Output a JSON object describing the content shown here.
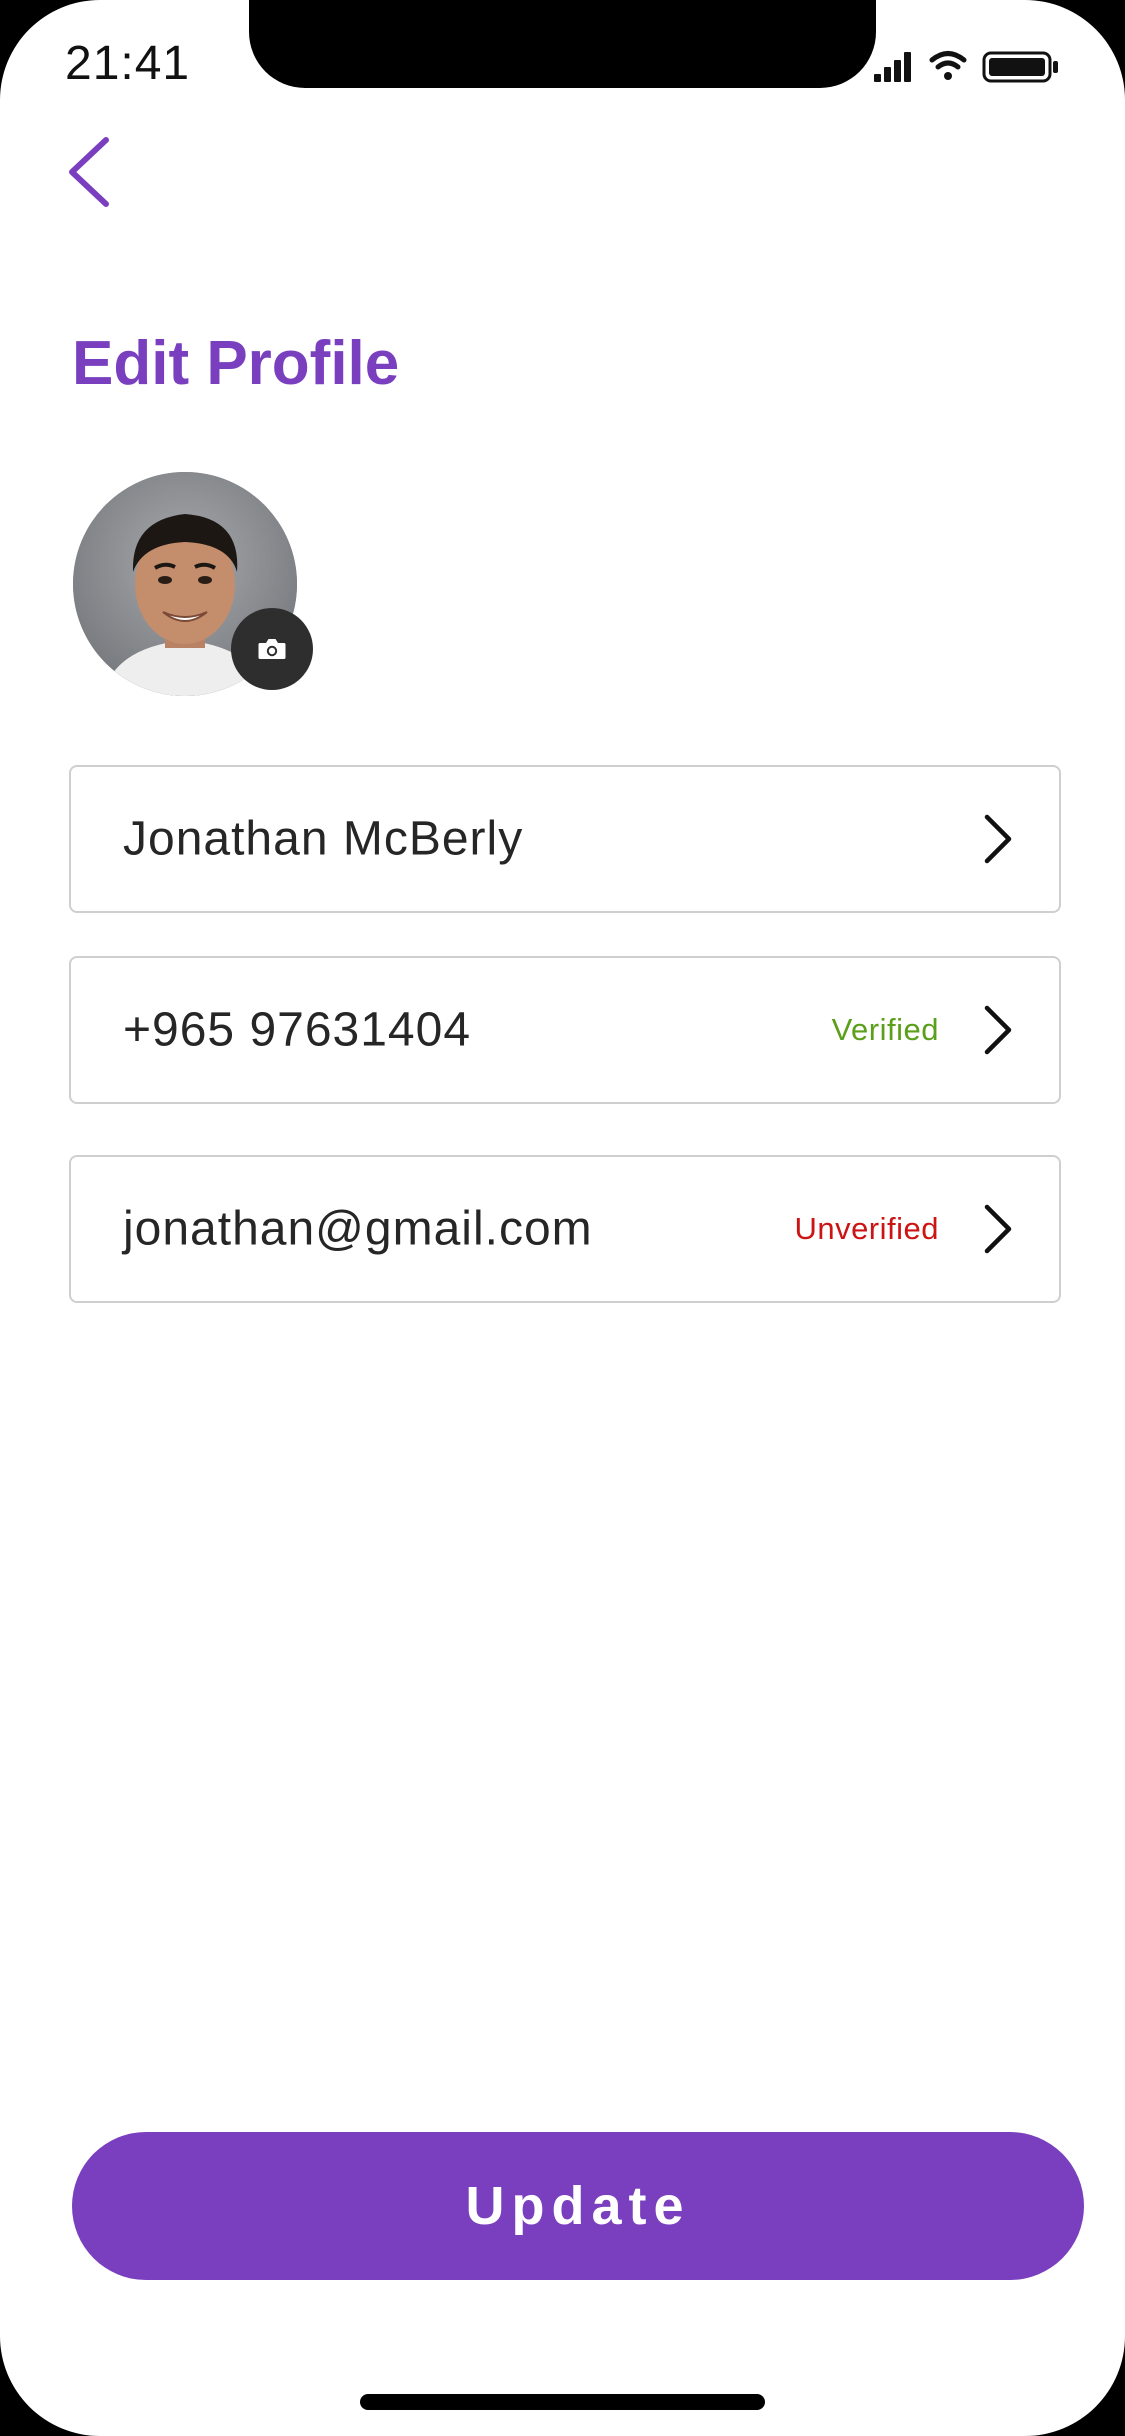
{
  "status_bar": {
    "time": "21:41",
    "icons": [
      "cellular-signal-icon",
      "wifi-icon",
      "battery-icon"
    ]
  },
  "header": {
    "back_icon": "chevron-left-icon",
    "title": "Edit Profile"
  },
  "avatar": {
    "camera_icon": "camera-icon"
  },
  "fields": [
    {
      "value": "Jonathan McBerly",
      "status": ""
    },
    {
      "value": "+965 97631404",
      "status": "Verified"
    },
    {
      "value": "jonathan@gmail.com",
      "status": "Unverified"
    }
  ],
  "actions": {
    "update_label": "Update"
  },
  "colors": {
    "accent": "#7a3fbf",
    "verified": "#5aa01a",
    "unverified": "#cc1414",
    "border": "#cfcfcf"
  }
}
